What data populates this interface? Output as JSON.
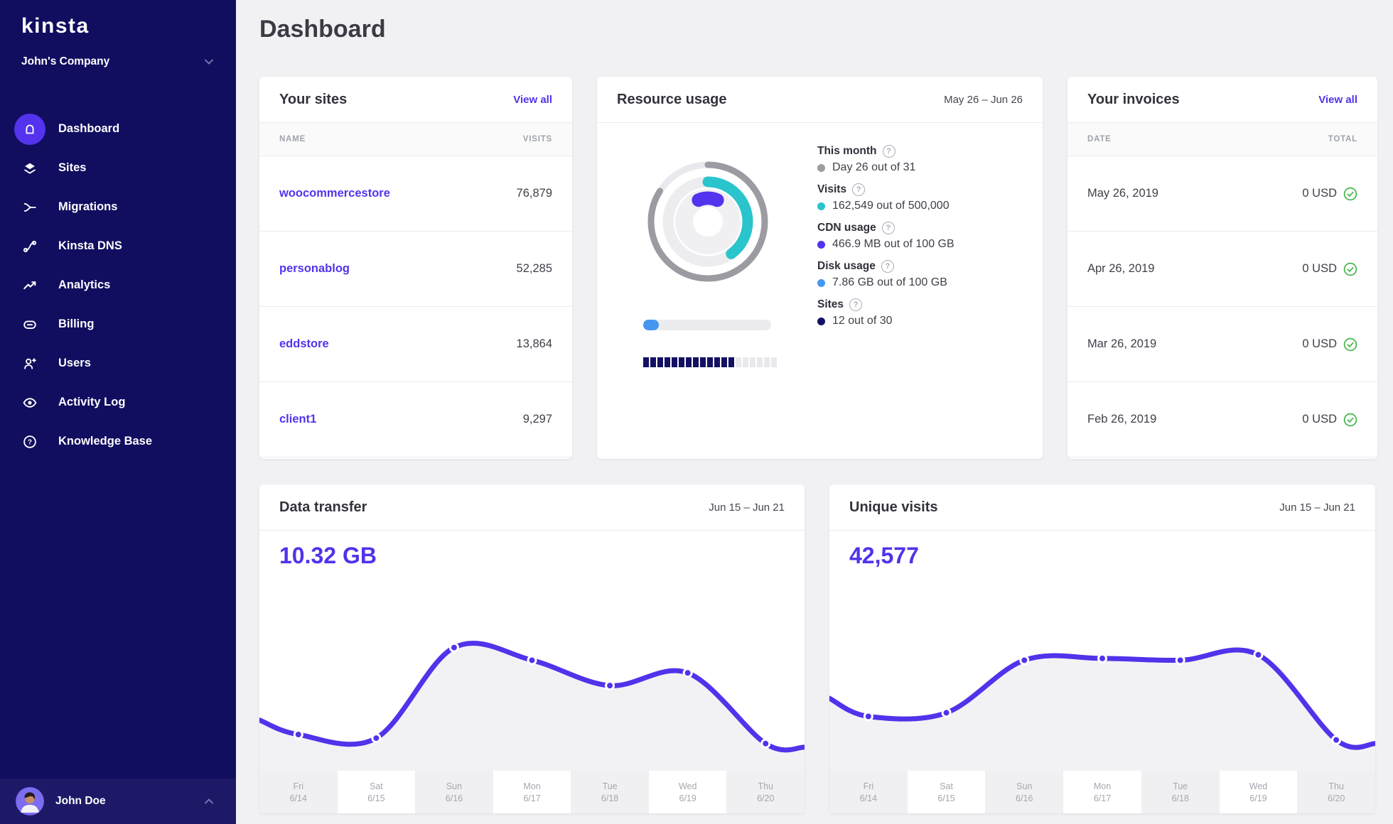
{
  "brand": {
    "logo": "kinsta",
    "company": "John's Company"
  },
  "sidebar": {
    "items": [
      {
        "label": "Dashboard",
        "icon": "home",
        "active": true
      },
      {
        "label": "Sites",
        "icon": "layers",
        "active": false
      },
      {
        "label": "Migrations",
        "icon": "merge",
        "active": false
      },
      {
        "label": "Kinsta DNS",
        "icon": "dns",
        "active": false
      },
      {
        "label": "Analytics",
        "icon": "trend",
        "active": false
      },
      {
        "label": "Billing",
        "icon": "card",
        "active": false
      },
      {
        "label": "Users",
        "icon": "user-plus",
        "active": false
      },
      {
        "label": "Activity Log",
        "icon": "eye",
        "active": false
      },
      {
        "label": "Knowledge Base",
        "icon": "question",
        "active": false
      }
    ],
    "user": {
      "name": "John Doe"
    }
  },
  "page": {
    "title": "Dashboard"
  },
  "your_sites": {
    "title": "Your sites",
    "action": "View all",
    "columns": [
      "NAME",
      "VISITS"
    ],
    "rows": [
      {
        "name": "woocommercestore",
        "visits": "76,879"
      },
      {
        "name": "personablog",
        "visits": "52,285"
      },
      {
        "name": "eddstore",
        "visits": "13,864"
      },
      {
        "name": "client1",
        "visits": "9,297"
      }
    ]
  },
  "resource_usage": {
    "title": "Resource usage",
    "range": "May 26 – Jun 26",
    "stats": [
      {
        "label": "This month",
        "value": "Day 26 out of 31",
        "color": "#9b9ba1"
      },
      {
        "label": "Visits",
        "value": "162,549 out of 500,000",
        "color": "#2ac4cd"
      },
      {
        "label": "CDN usage",
        "value": "466.9 MB out of 100 GB",
        "color": "#5333ed"
      },
      {
        "label": "Disk usage",
        "value": "7.86 GB out of 100 GB",
        "color": "#4596f1"
      },
      {
        "label": "Sites",
        "value": "12 out of 30",
        "color": "#131163"
      }
    ],
    "arc_fractions": {
      "month": 0.84,
      "visits": 0.4,
      "cdn": 0.13
    },
    "disk_bar_fraction": 0.0786,
    "sites_segments": {
      "filled": 13,
      "total": 19
    }
  },
  "your_invoices": {
    "title": "Your invoices",
    "action": "View all",
    "columns": [
      "DATE",
      "TOTAL"
    ],
    "rows": [
      {
        "date": "May 26, 2019",
        "total": "0 USD",
        "status": "paid"
      },
      {
        "date": "Apr 26, 2019",
        "total": "0 USD",
        "status": "paid"
      },
      {
        "date": "Mar 26, 2019",
        "total": "0 USD",
        "status": "paid"
      },
      {
        "date": "Feb 26, 2019",
        "total": "0 USD",
        "status": "paid"
      }
    ]
  },
  "chart_data": [
    {
      "type": "line",
      "title": "Data transfer",
      "range": "Jun 15 – Jun 21",
      "total_label": "10.32 GB",
      "categories": [
        "Fri 6/14",
        "Sat 6/15",
        "Sun 6/16",
        "Mon 6/17",
        "Tue 6/18",
        "Wed 6/19",
        "Thu 6/20"
      ],
      "labels": [
        {
          "day": "Fri",
          "date": "6/14"
        },
        {
          "day": "Sat",
          "date": "6/15"
        },
        {
          "day": "Sun",
          "date": "6/16"
        },
        {
          "day": "Mon",
          "date": "6/17"
        },
        {
          "day": "Tue",
          "date": "6/18"
        },
        {
          "day": "Wed",
          "date": "6/19"
        },
        {
          "day": "Thu",
          "date": "6/20"
        }
      ],
      "values_est_gb": [
        1.05,
        0.95,
        2.15,
        1.95,
        1.55,
        1.8,
        0.85
      ],
      "y_fractions": [
        0.8,
        0.82,
        0.32,
        0.39,
        0.53,
        0.46,
        0.85
      ],
      "edge_fractions": [
        0.72,
        0.87
      ],
      "grid": false,
      "legend": "none",
      "line_color": "#5232ea",
      "area_color": "#f2f2f5"
    },
    {
      "type": "line",
      "title": "Unique visits",
      "range": "Jun 15 – Jun 21",
      "total_label": "42,577",
      "categories": [
        "Fri 6/14",
        "Sat 6/15",
        "Sun 6/16",
        "Mon 6/17",
        "Tue 6/18",
        "Wed 6/19",
        "Thu 6/20"
      ],
      "labels": [
        {
          "day": "Fri",
          "date": "6/14"
        },
        {
          "day": "Sat",
          "date": "6/15"
        },
        {
          "day": "Sun",
          "date": "6/16"
        },
        {
          "day": "Mon",
          "date": "6/17"
        },
        {
          "day": "Tue",
          "date": "6/18"
        },
        {
          "day": "Wed",
          "date": "6/19"
        },
        {
          "day": "Thu",
          "date": "6/20"
        }
      ],
      "values_est": [
        3900,
        4200,
        7900,
        8100,
        7900,
        8350,
        2230
      ],
      "y_fractions": [
        0.7,
        0.68,
        0.39,
        0.38,
        0.39,
        0.36,
        0.83
      ],
      "edge_fractions": [
        0.6,
        0.85
      ],
      "grid": false,
      "legend": "none",
      "line_color": "#5232ea",
      "area_color": "#f2f2f5"
    }
  ],
  "colors": {
    "accent": "#5333ed",
    "sidebar": "#110d5f",
    "teal": "#2ac4cd",
    "blue": "#4596f1",
    "gray_ring": "#9b9ba1",
    "navy_dot": "#131163",
    "green": "#43b649",
    "page_bg": "#f1f1f4"
  }
}
